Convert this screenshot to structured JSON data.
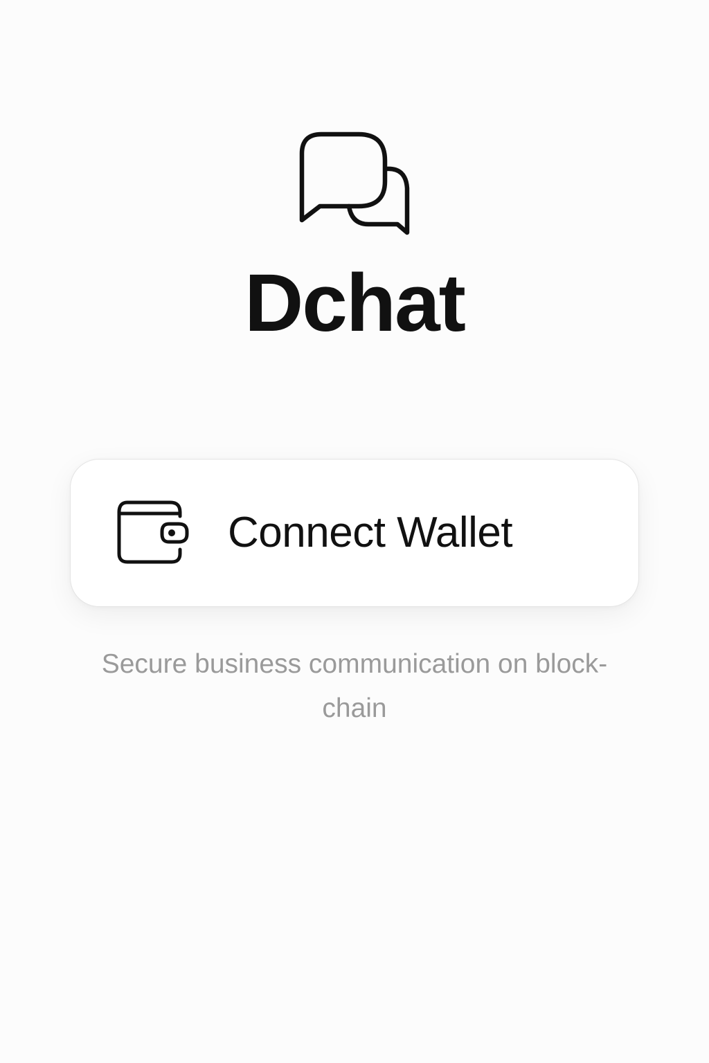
{
  "app": {
    "name": "Dchat",
    "logo_icon": "chat-bubbles-icon"
  },
  "connect": {
    "label": "Connect Wallet",
    "icon": "wallet-icon"
  },
  "tagline": "Secure business communication on block-chain",
  "colors": {
    "background": "#fcfcfc",
    "text_primary": "#111111",
    "text_secondary": "#9a9a9a",
    "button_background": "#ffffff",
    "button_border": "#e4e4e4"
  }
}
